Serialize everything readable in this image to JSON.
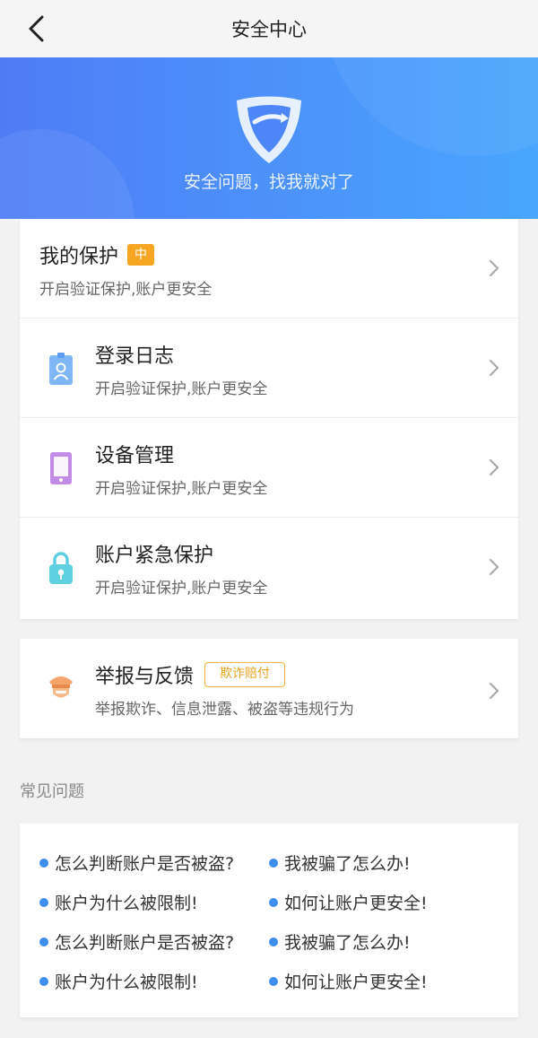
{
  "nav": {
    "title": "安全中心",
    "back_icon": "chevron-left-icon"
  },
  "banner": {
    "slogan": "安全问题，找我就对了",
    "shield_icon": "shield-icon"
  },
  "colors": {
    "primary_blue": "#4b95fb",
    "badge_orange": "#f6a623",
    "dot_blue": "#3d8ef0"
  },
  "protection": {
    "title": "我的保护",
    "level_badge": "中",
    "subtitle": "开启验证保护,账户更安全"
  },
  "items": [
    {
      "title": "登录日志",
      "subtitle": "开启验证保护,账户更安全",
      "icon": "id-badge-icon"
    },
    {
      "title": "设备管理",
      "subtitle": "开启验证保护,账户更安全",
      "icon": "device-icon"
    },
    {
      "title": "账户紧急保护",
      "subtitle": "开启验证保护,账户更安全",
      "icon": "lock-icon"
    }
  ],
  "report": {
    "title": "举报与反馈",
    "badge": "欺诈赔付",
    "subtitle": "举报欺诈、信息泄露、被盗等违规行为",
    "icon": "police-icon"
  },
  "faq": {
    "label": "常见问题",
    "questions": [
      "怎么判断账户是否被盗?",
      "我被骗了怎么办!",
      "账户为什么被限制!",
      "如何让账户更安全!",
      "怎么判断账户是否被盗?",
      "我被骗了怎么办!",
      "账户为什么被限制!",
      "如何让账户更安全!"
    ]
  }
}
